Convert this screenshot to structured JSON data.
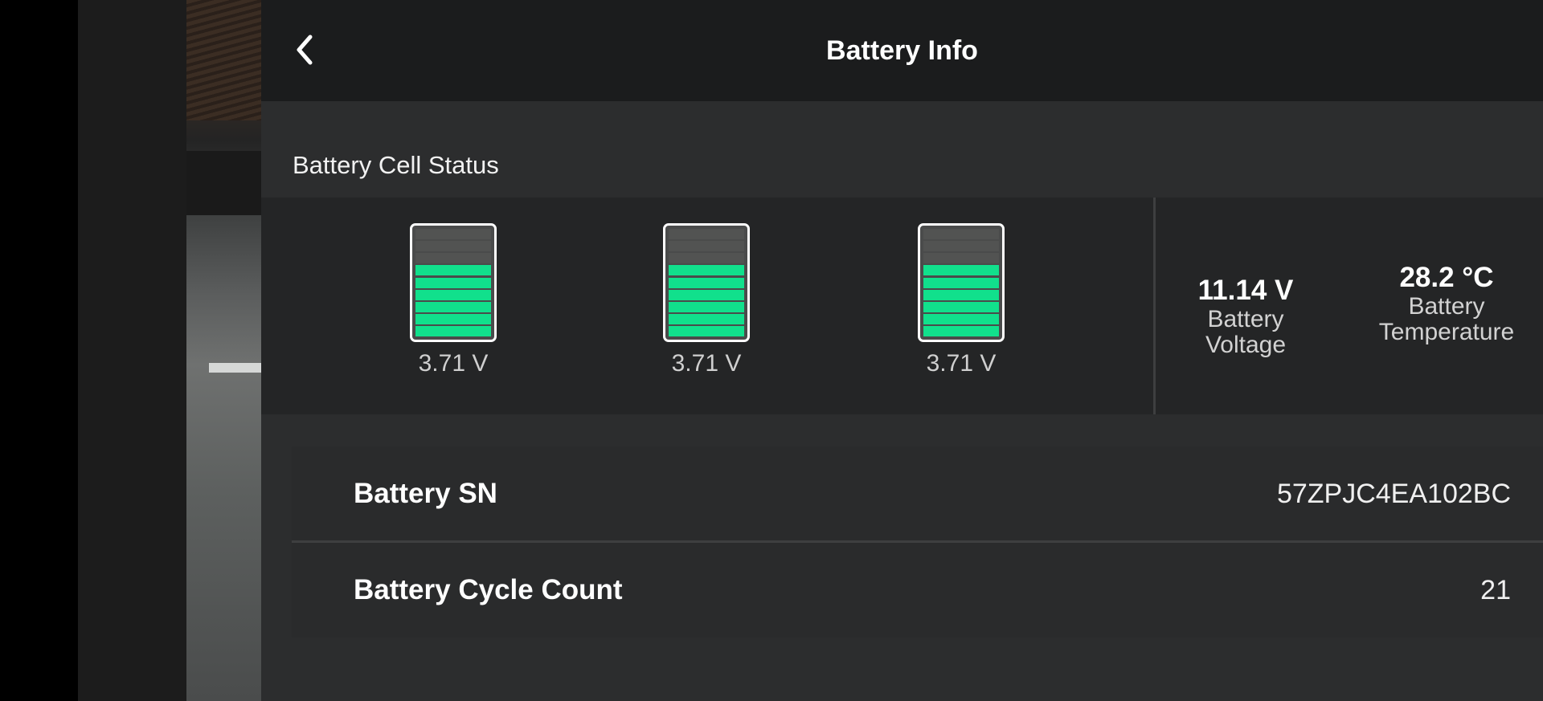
{
  "header": {
    "title": "Battery Info",
    "back_icon": "chevron-left-icon"
  },
  "cell_status": {
    "label": "Battery Cell Status",
    "cells": [
      {
        "voltage": "3.71 V",
        "level_segments_on": 6,
        "segments_total": 9
      },
      {
        "voltage": "3.71 V",
        "level_segments_on": 6,
        "segments_total": 9
      },
      {
        "voltage": "3.71 V",
        "level_segments_on": 6,
        "segments_total": 9
      }
    ],
    "colors": {
      "charged": "#11e08c",
      "empty": "#525352"
    }
  },
  "metrics": {
    "voltage": {
      "value": "11.14 V",
      "label": "Battery Voltage"
    },
    "temperature": {
      "value": "28.2 °C",
      "label_line1": "Battery",
      "label_line2": "Temperature"
    }
  },
  "info": {
    "serial": {
      "label": "Battery SN",
      "value": "57ZPJC4EA102BC"
    },
    "cycles": {
      "label": "Battery Cycle Count",
      "value": "21"
    }
  }
}
